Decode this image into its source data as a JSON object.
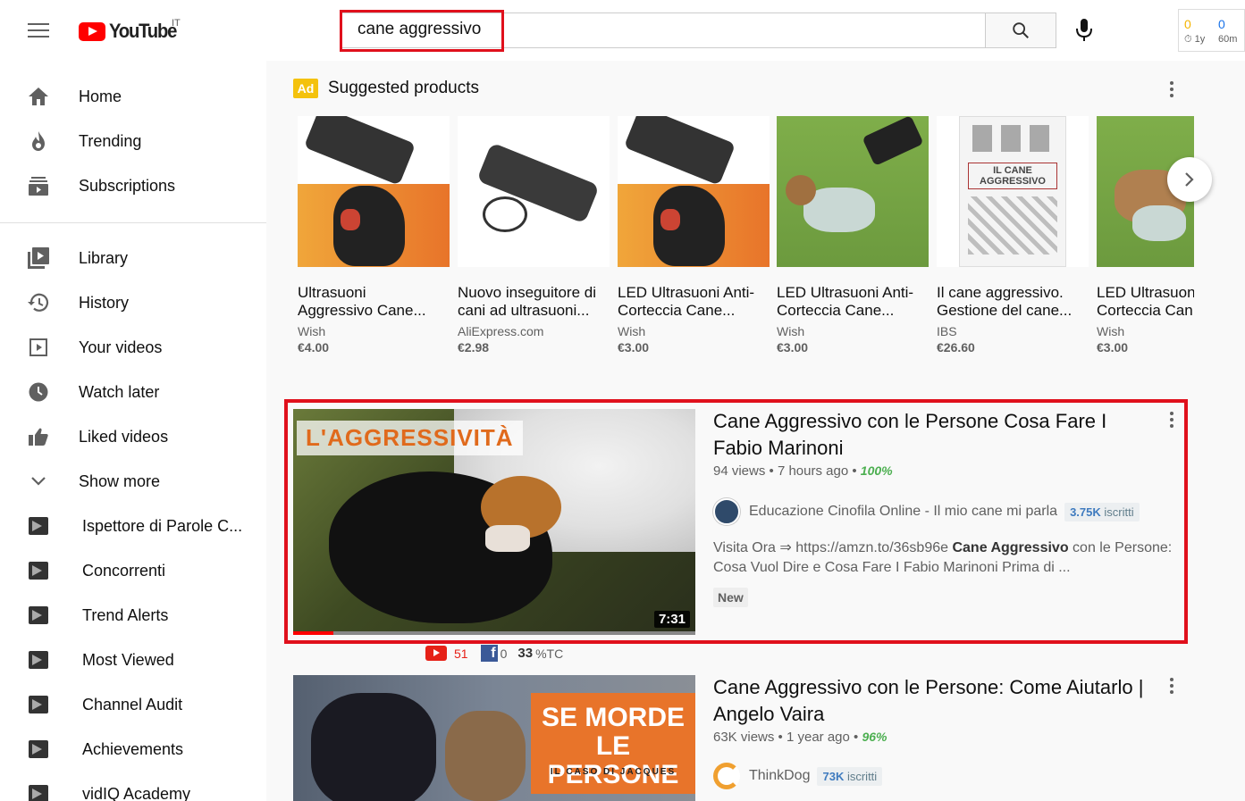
{
  "header": {
    "logo_text": "YouTube",
    "logo_region": "IT",
    "search_value": "cane aggressivo",
    "stats": {
      "n1": "0",
      "n2": "0",
      "l1": "1y",
      "l2": "60m"
    }
  },
  "sidebar": {
    "primary": [
      {
        "label": "Home",
        "icon": "home-icon"
      },
      {
        "label": "Trending",
        "icon": "flame-icon"
      },
      {
        "label": "Subscriptions",
        "icon": "subscriptions-icon"
      }
    ],
    "secondary": [
      {
        "label": "Library",
        "icon": "library-icon"
      },
      {
        "label": "History",
        "icon": "history-icon"
      },
      {
        "label": "Your videos",
        "icon": "your-videos-icon"
      },
      {
        "label": "Watch later",
        "icon": "clock-icon"
      },
      {
        "label": "Liked videos",
        "icon": "thumbs-up-icon"
      },
      {
        "label": "Show more",
        "icon": "chevron-down-icon"
      }
    ],
    "vidiq": [
      {
        "label": "Ispettore di Parole C..."
      },
      {
        "label": "Concorrenti"
      },
      {
        "label": "Trend Alerts"
      },
      {
        "label": "Most Viewed"
      },
      {
        "label": "Channel Audit"
      },
      {
        "label": "Achievements"
      },
      {
        "label": "vidIQ Academy"
      }
    ]
  },
  "suggested": {
    "ad_label": "Ad",
    "title": "Suggested products",
    "products": [
      {
        "line1": "Ultrasuoni",
        "line2": "Aggressivo Cane...",
        "store": "Wish",
        "price": "€4.00"
      },
      {
        "line1": "Nuovo inseguitore di",
        "line2": "cani ad ultrasuoni...",
        "store": "AliExpress.com",
        "price": "€2.98"
      },
      {
        "line1": "LED Ultrasuoni Anti-",
        "line2": "Corteccia Cane...",
        "store": "Wish",
        "price": "€3.00"
      },
      {
        "line1": "LED Ultrasuoni Anti-",
        "line2": "Corteccia Cane...",
        "store": "Wish",
        "price": "€3.00"
      },
      {
        "line1": "Il cane aggressivo.",
        "line2": "Gestione del cane...",
        "store": "IBS",
        "price": "€26.60"
      },
      {
        "line1": "LED Ultrasuon",
        "line2": "Corteccia Can",
        "store": "Wish",
        "price": "€3.00"
      }
    ],
    "book_cover_title": "IL CANE AGGRESSIVO"
  },
  "videos": [
    {
      "title": "Cane Aggressivo con le Persone Cosa Fare I Fabio Marinoni",
      "views": "94 views",
      "age": "7 hours ago",
      "pct": "100%",
      "channel": "Educazione Cinofila Online - Il mio cane mi parla",
      "subs_num": "3.75K",
      "subs_label": "iscritti",
      "desc_pre": "Visita Ora ⇒ https://amzn.to/36sb96e ",
      "desc_bold": "Cane Aggressivo",
      "desc_post": " con le Persone: Cosa Vuol Dire e Cosa Fare I Fabio Marinoni Prima di ...",
      "badge": "New",
      "duration": "7:31",
      "thumb_text": "L'AGGRESSIVITÀ",
      "stats": {
        "yt": "51",
        "fb": "0",
        "tc_num": "33",
        "tc_label": "%TC"
      }
    },
    {
      "title": "Cane Aggressivo con le Persone: Come Aiutarlo | Angelo Vaira",
      "views": "63K views",
      "age": "1 year ago",
      "pct": "96%",
      "channel": "ThinkDog",
      "subs_num": "73K",
      "subs_label": "iscritti",
      "thumb_line1": "SE MORDE",
      "thumb_line2": "LE PERSONE",
      "thumb_line3": "IL CASO DI JACQUES"
    }
  ]
}
